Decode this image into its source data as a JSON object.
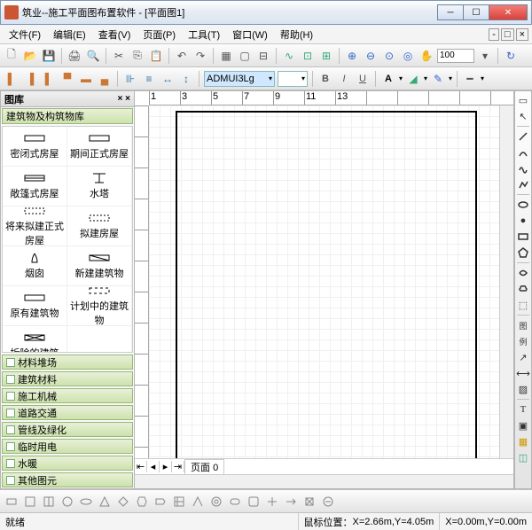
{
  "app": {
    "title": "筑业--施工平面图布置软件 - [平面图1]"
  },
  "menu": [
    "文件(F)",
    "编辑(E)",
    "查看(V)",
    "页面(P)",
    "工具(T)",
    "窗口(W)",
    "帮助(H)"
  ],
  "toolbar2": {
    "zoom_value": "100",
    "font_name": "ADMUI3Lg"
  },
  "panel": {
    "title": "图库",
    "active_category": "建筑物及构筑物库",
    "items": [
      [
        "密闭式房屋",
        "期间正式房屋"
      ],
      [
        "敞篷式房屋",
        "水塔"
      ],
      [
        "将来拟建正式房屋",
        "拟建房屋"
      ],
      [
        "烟囱",
        "新建建筑物"
      ],
      [
        "原有建筑物",
        "计划中的建筑物"
      ],
      [
        "拆除的建筑",
        ""
      ]
    ],
    "categories": [
      "材料堆场",
      "建筑材料",
      "施工机械",
      "道路交通",
      "管线及绿化",
      "临时用电",
      "水暖",
      "其他图元"
    ]
  },
  "ruler_h": [
    "1",
    "3",
    "5",
    "7",
    "9",
    "11",
    "13"
  ],
  "tabs": {
    "label": "页面",
    "index": "0"
  },
  "status": {
    "ready": "就绪",
    "mouse_label": "鼠标位置：",
    "mouse_pos": "X=2.66m,Y=4.05m",
    "origin": "X=0.00m,Y=0.00m"
  }
}
